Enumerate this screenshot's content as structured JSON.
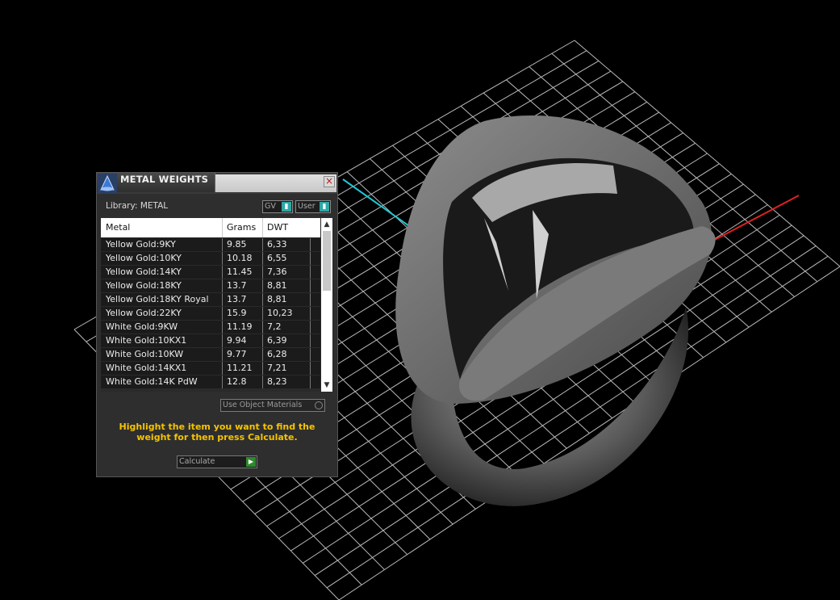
{
  "panel": {
    "title": "METAL WEIGHTS",
    "library_label": "Library: METAL",
    "gv_label": "GV",
    "user_label": "User",
    "columns": [
      "Metal",
      "Grams",
      "DWT"
    ],
    "rows": [
      {
        "metal": "Yellow Gold:9KY",
        "grams": "9.85",
        "dwt": "6,33"
      },
      {
        "metal": "Yellow Gold:10KY",
        "grams": "10.18",
        "dwt": "6,55"
      },
      {
        "metal": "Yellow Gold:14KY",
        "grams": "11.45",
        "dwt": "7,36"
      },
      {
        "metal": "Yellow Gold:18KY",
        "grams": "13.7",
        "dwt": "8,81"
      },
      {
        "metal": "Yellow Gold:18KY Royal",
        "grams": "13.7",
        "dwt": "8,81"
      },
      {
        "metal": "Yellow Gold:22KY",
        "grams": "15.9",
        "dwt": "10,23"
      },
      {
        "metal": "White Gold:9KW",
        "grams": "11.19",
        "dwt": "7,2"
      },
      {
        "metal": "White Gold:10KX1",
        "grams": "9.94",
        "dwt": "6,39"
      },
      {
        "metal": "White Gold:10KW",
        "grams": "9.77",
        "dwt": "6,28"
      },
      {
        "metal": "White Gold:14KX1",
        "grams": "11.21",
        "dwt": "7,21"
      },
      {
        "metal": "White Gold:14K PdW",
        "grams": "12.8",
        "dwt": "8,23"
      }
    ],
    "use_object_materials": "Use Object Materials",
    "hint": "Highlight the item you want to find the weight for then press Calculate.",
    "calculate_label": "Calculate"
  },
  "colors": {
    "hint": "#f5c400",
    "grid": "#cfcfcf",
    "axis_x": "#e02020",
    "axis_y": "#1ec8d8"
  }
}
